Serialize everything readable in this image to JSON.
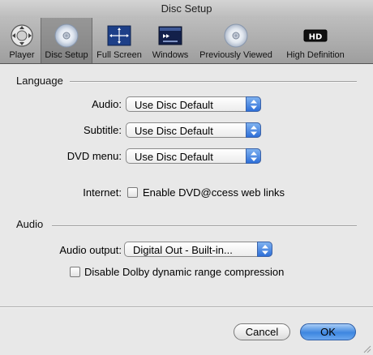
{
  "window": {
    "title": "Disc Setup"
  },
  "toolbar": {
    "items": [
      {
        "label": "Player",
        "icon": "player-gear-icon"
      },
      {
        "label": "Disc Setup",
        "icon": "disc-icon",
        "selected": true
      },
      {
        "label": "Full Screen",
        "icon": "full-screen-icon"
      },
      {
        "label": "Windows",
        "icon": "windows-icon"
      },
      {
        "label": "Previously Viewed",
        "icon": "previously-viewed-disc-icon"
      },
      {
        "label": "High Definition",
        "icon": "hd-icon"
      }
    ]
  },
  "language": {
    "title": "Language",
    "audio_label": "Audio:",
    "audio_value": "Use Disc Default",
    "subtitle_label": "Subtitle:",
    "subtitle_value": "Use Disc Default",
    "dvdmenu_label": "DVD menu:",
    "dvdmenu_value": "Use Disc Default",
    "internet_label": "Internet:",
    "internet_checkbox_label": "Enable DVD@ccess web links",
    "internet_checked": false
  },
  "audio": {
    "title": "Audio",
    "output_label": "Audio output:",
    "output_value": "Digital Out - Built-in...",
    "dolby_label": "Disable Dolby dynamic range compression",
    "dolby_checked": false
  },
  "buttons": {
    "cancel": "Cancel",
    "ok": "OK"
  },
  "colors": {
    "accent": "#3d86e0",
    "toolbar_bg": "#a8a8a8",
    "window_bg": "#e8e8e8"
  }
}
